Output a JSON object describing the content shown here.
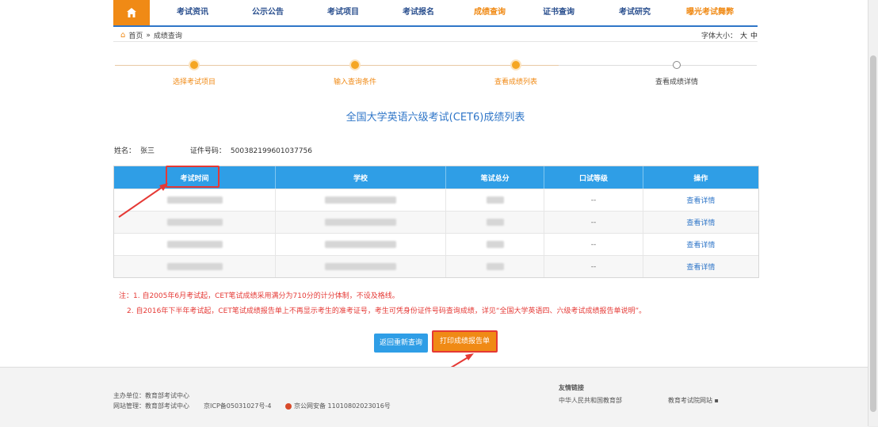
{
  "nav": {
    "items": [
      {
        "label": "考试资讯",
        "orange": false
      },
      {
        "label": "公示公告",
        "orange": false
      },
      {
        "label": "考试项目",
        "orange": false
      },
      {
        "label": "考试报名",
        "orange": false
      },
      {
        "label": "成绩查询",
        "orange": true
      },
      {
        "label": "证书查询",
        "orange": false
      },
      {
        "label": "考试研究",
        "orange": false
      },
      {
        "label": "曝光考试舞弊",
        "orange": true
      }
    ]
  },
  "breadcrumb": {
    "home": "首页",
    "sep": "»",
    "current": "成绩查询"
  },
  "font_size": {
    "label": "字体大小：",
    "large": "大",
    "medium": "中"
  },
  "steps": [
    {
      "label": "选择考试项目",
      "done": true
    },
    {
      "label": "输入查询条件",
      "done": true
    },
    {
      "label": "查看成绩列表",
      "done": true
    },
    {
      "label": "查看成绩详情",
      "done": false
    }
  ],
  "title": "全国大学英语六级考试(CET6)成绩列表",
  "info": {
    "name_label": "姓名：",
    "name_value": "张三",
    "id_label": "证件号码：",
    "id_value": "500382199601037756"
  },
  "table": {
    "headers": [
      "考试时间",
      "学校",
      "笔试总分",
      "口试等级",
      "操作"
    ],
    "rows": [
      {
        "oral": "--",
        "action": "查看详情"
      },
      {
        "oral": "--",
        "action": "查看详情"
      },
      {
        "oral": "--",
        "action": "查看详情"
      },
      {
        "oral": "--",
        "action": "查看详情"
      }
    ]
  },
  "notes": {
    "line1": "注：1. 自2005年6月考试起，CET笔试成绩采用满分为710分的计分体制，不设及格线。",
    "line2": "2. 自2016年下半年考试起，CET笔试成绩报告单上不再显示考生的准考证号，考生可凭身份证件号码查询成绩，详见“全国大学英语四、六级考试成绩报告单说明”。"
  },
  "buttons": {
    "back": "返回重新查询",
    "print": "打印成绩报告单"
  },
  "footer": {
    "sponsor": "主办单位：教育部考试中心",
    "operator": "网站管理：教育部考试中心",
    "icp": "京ICP备05031027号-4",
    "police": "京公网安备 11010802023016号",
    "links_title": "友情链接",
    "link1": "中华人民共和国教育部",
    "link2": "教育考试院网站"
  },
  "colors": {
    "brand_blue": "#2f76c8",
    "accent_orange": "#f08a15",
    "annotation_red": "#e53935"
  }
}
